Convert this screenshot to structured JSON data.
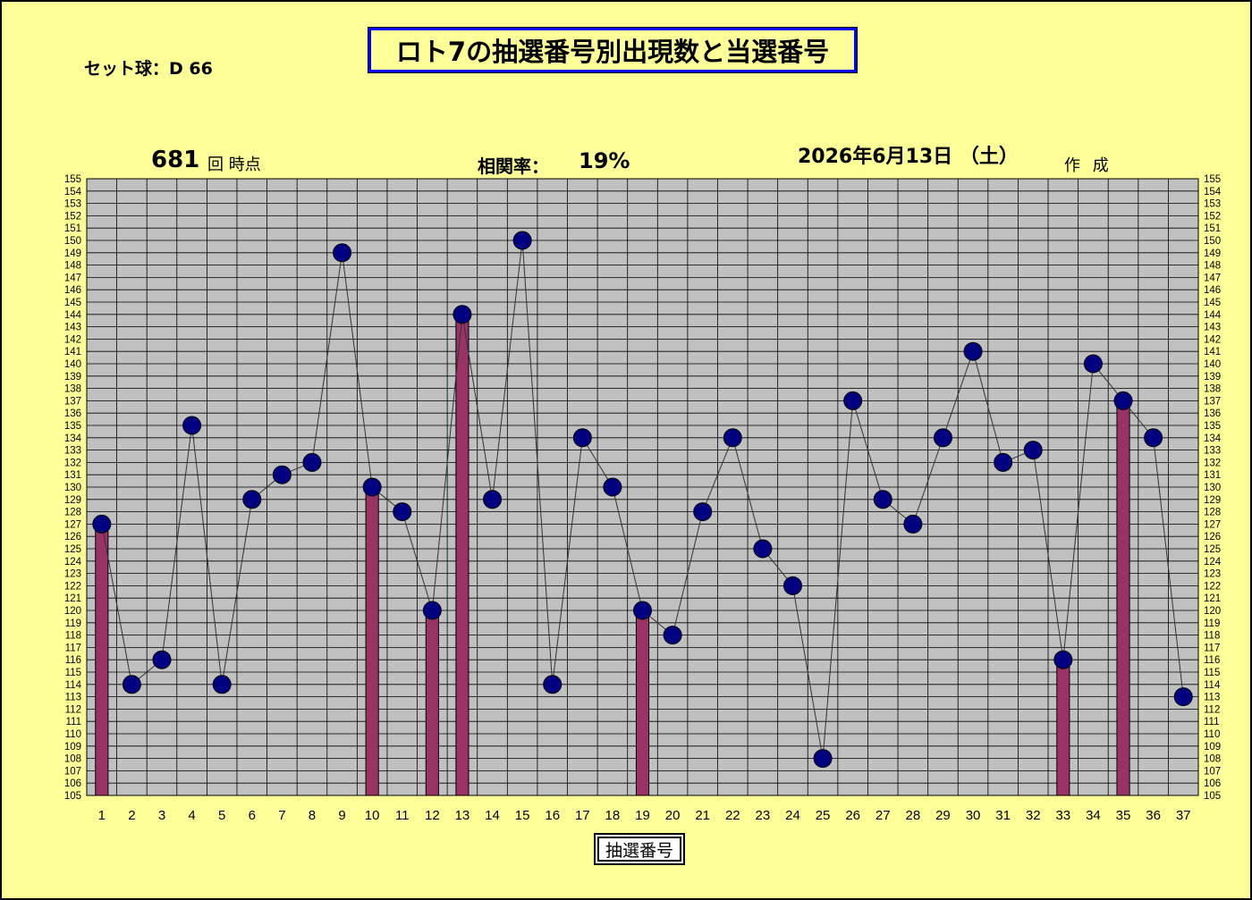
{
  "title": "ロト7の抽選番号別出現数と当選番号",
  "set_ball": "セット球：D 66",
  "round_number": "681",
  "round_label": "回  時点",
  "correlation_label": "相関率：",
  "correlation_value": "19%",
  "date_text": "2026年6月13日 （土）",
  "made_label": "作 成",
  "x_axis_label": "抽選番号",
  "colors": {
    "background": "#ffff99",
    "plot_area": "#c0c0c0",
    "bar": "#993366",
    "marker": "#000080",
    "title_border": "#0000ff"
  },
  "chart_data": {
    "type": "bar+line",
    "categories": [
      1,
      2,
      3,
      4,
      5,
      6,
      7,
      8,
      9,
      10,
      11,
      12,
      13,
      14,
      15,
      16,
      17,
      18,
      19,
      20,
      21,
      22,
      23,
      24,
      25,
      26,
      27,
      28,
      29,
      30,
      31,
      32,
      33,
      34,
      35,
      36,
      37
    ],
    "series": [
      {
        "type": "line",
        "values": [
          127,
          114,
          116,
          135,
          114,
          129,
          131,
          132,
          149,
          130,
          128,
          120,
          144,
          129,
          150,
          114,
          134,
          130,
          120,
          118,
          128,
          134,
          125,
          122,
          108,
          137,
          129,
          127,
          134,
          141,
          132,
          133,
          116,
          140,
          137,
          134,
          113
        ]
      },
      {
        "type": "bar",
        "winning_numbers": [
          1,
          10,
          12,
          13,
          19,
          33,
          35
        ]
      }
    ],
    "ylim": [
      105,
      155
    ],
    "y_tick_step": 1,
    "grid": true,
    "y_axis_both_sides": true
  }
}
